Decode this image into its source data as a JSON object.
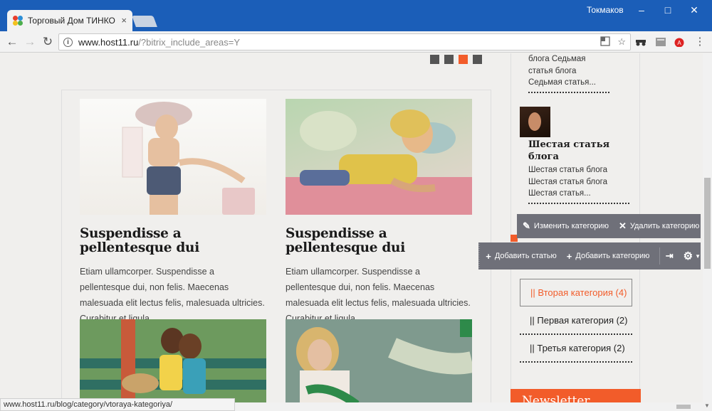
{
  "browser": {
    "tab_title": "Торговый Дом ТИНКО",
    "tab_close": "×",
    "user_name": "Токмаков",
    "url_host": "www.host11.ru",
    "url_path": "/?bitrix_include_areas=Y",
    "status_url": "www.host11.ru/blog/category/vtoraya-kategoriya/"
  },
  "slider": {
    "active_index": 2,
    "count": 4
  },
  "posts": [
    {
      "title": "Suspendisse a pellentesque dui",
      "text": "Etiam ullamcorper. Suspendisse a pellentesque dui, non felis. Maecenas malesuada elit lectus felis, malesuada ultricies. Curabitur et ligula."
    },
    {
      "title": "Suspendisse a pellentesque dui",
      "text": "Etiam ullamcorper. Suspendisse a pellentesque dui, non felis. Maecenas malesuada elit lectus felis, malesuada ultricies. Curabitur et ligula."
    }
  ],
  "sidebar": {
    "prev_article_text": "блога Седьмая статья блога Седьмая статья...",
    "article": {
      "title": "Шестая статья блога",
      "text": "Шестая статья блога Шестая статья блога Шестая статья..."
    },
    "categories": [
      {
        "label": "|| Вторая категория (4)",
        "active": true
      },
      {
        "label": "|| Первая категория (2)",
        "active": false
      },
      {
        "label": "|| Третья категория (2)",
        "active": false
      }
    ],
    "newsletter": "Newsletter"
  },
  "edit_panel": {
    "edit_category": "Изменить категорию",
    "delete_category": "Удалить категорию",
    "add_article": "Добавить статью",
    "add_category": "Добавить категорию"
  },
  "colors": {
    "accent": "#f25c2a",
    "titlebar": "#1b5eb8",
    "panel": "#6f7079"
  }
}
